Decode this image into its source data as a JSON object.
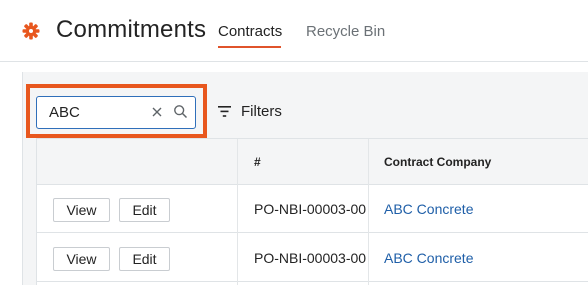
{
  "header": {
    "title": "Commitments",
    "logo_icon": "gear-icon",
    "accent_color": "#e8571e",
    "tabs": [
      {
        "label": "Contracts",
        "active": true
      },
      {
        "label": "Recycle Bin",
        "active": false
      }
    ]
  },
  "toolbar": {
    "search": {
      "value": "ABC",
      "clear_icon": "close-icon",
      "search_icon": "search-icon"
    },
    "filters": {
      "label": "Filters",
      "icon": "filter-icon"
    }
  },
  "table": {
    "columns": [
      "",
      "#",
      "Contract Company"
    ],
    "rows": [
      {
        "view_label": "View",
        "edit_label": "Edit",
        "number": "PO-NBI-00003-00",
        "company": "ABC Concrete"
      },
      {
        "view_label": "View",
        "edit_label": "Edit",
        "number": "PO-NBI-00003-00",
        "company": "ABC Concrete"
      }
    ]
  }
}
